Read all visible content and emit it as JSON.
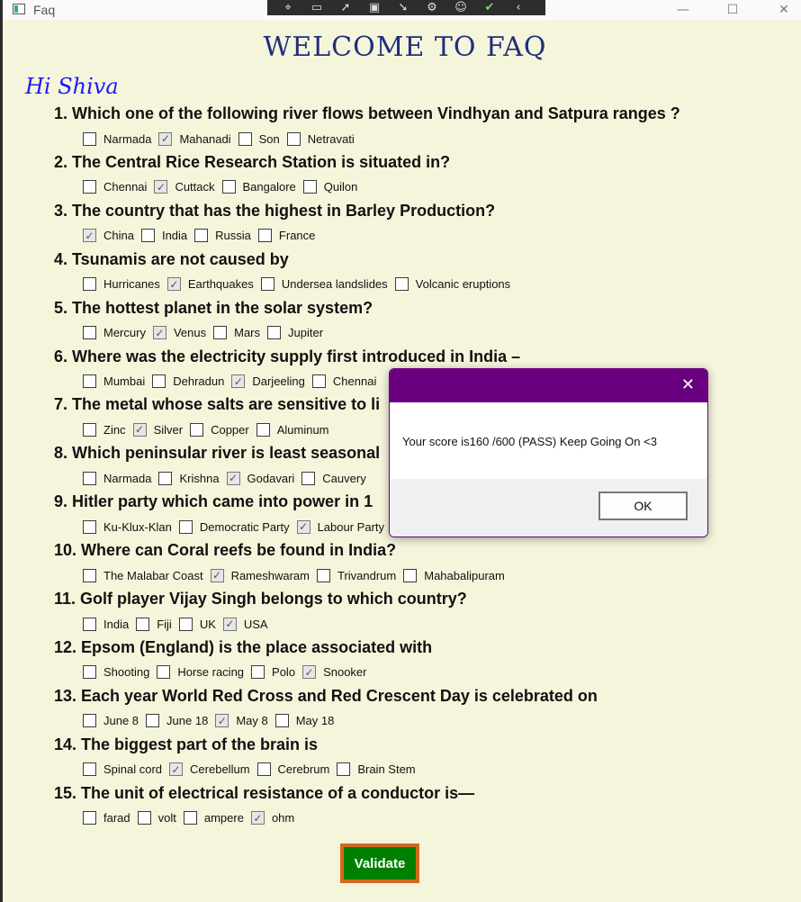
{
  "window": {
    "title": "Faq"
  },
  "toolbar_icons": [
    "region-select-icon",
    "video-icon",
    "cursor-icon",
    "frame-icon",
    "cursor-click-icon",
    "settings-icon",
    "accessibility-icon",
    "check-icon",
    "chevron-left-icon"
  ],
  "heading": "WELCOME TO FAQ",
  "greeting": "Hi Shiva",
  "questions": [
    {
      "text": "1. Which one of the following river flows between Vindhyan and Satpura ranges ?",
      "options": [
        {
          "label": "Narmada",
          "checked": false
        },
        {
          "label": "Mahanadi",
          "checked": true
        },
        {
          "label": "Son",
          "checked": false
        },
        {
          "label": "Netravati",
          "checked": false
        }
      ]
    },
    {
      "text": "2. The Central Rice Research Station is situated in?",
      "options": [
        {
          "label": "Chennai",
          "checked": false
        },
        {
          "label": "Cuttack",
          "checked": true
        },
        {
          "label": "Bangalore",
          "checked": false
        },
        {
          "label": "Quilon",
          "checked": false
        }
      ]
    },
    {
      "text": "3. The country that has the highest in Barley Production?",
      "options": [
        {
          "label": "China",
          "checked": true
        },
        {
          "label": "India",
          "checked": false
        },
        {
          "label": "Russia",
          "checked": false
        },
        {
          "label": "France",
          "checked": false
        }
      ]
    },
    {
      "text": "4. Tsunamis are not caused by",
      "options": [
        {
          "label": "Hurricanes",
          "checked": false
        },
        {
          "label": "Earthquakes",
          "checked": true
        },
        {
          "label": "Undersea landslides",
          "checked": false
        },
        {
          "label": "Volcanic eruptions",
          "checked": false
        }
      ]
    },
    {
      "text": "5. The hottest planet in the solar system?",
      "options": [
        {
          "label": "Mercury",
          "checked": false
        },
        {
          "label": "Venus",
          "checked": true
        },
        {
          "label": "Mars",
          "checked": false
        },
        {
          "label": "Jupiter",
          "checked": false
        }
      ]
    },
    {
      "text": "6. Where was the electricity supply first introduced in India –",
      "options": [
        {
          "label": "Mumbai",
          "checked": false
        },
        {
          "label": "Dehradun",
          "checked": false
        },
        {
          "label": "Darjeeling",
          "checked": true
        },
        {
          "label": "Chennai",
          "checked": false
        }
      ]
    },
    {
      "text": "7. The metal whose salts are sensitive to li",
      "options": [
        {
          "label": "Zinc",
          "checked": false
        },
        {
          "label": "Silver",
          "checked": true
        },
        {
          "label": "Copper",
          "checked": false
        },
        {
          "label": "Aluminum",
          "checked": false
        }
      ]
    },
    {
      "text": "8. Which peninsular river is least seasonal",
      "options": [
        {
          "label": "Narmada",
          "checked": false
        },
        {
          "label": "Krishna",
          "checked": false
        },
        {
          "label": "Godavari",
          "checked": true
        },
        {
          "label": "Cauvery",
          "checked": false
        }
      ]
    },
    {
      "text": "9. Hitler party which came into power in 1",
      "options": [
        {
          "label": "Ku-Klux-Klan",
          "checked": false
        },
        {
          "label": "Democratic Party",
          "checked": false
        },
        {
          "label": "Labour Party",
          "checked": true
        }
      ]
    },
    {
      "text": "10. Where can Coral reefs be found in India?",
      "options": [
        {
          "label": "The Malabar Coast",
          "checked": false
        },
        {
          "label": "Rameshwaram",
          "checked": true
        },
        {
          "label": "Trivandrum",
          "checked": false
        },
        {
          "label": "Mahabalipuram",
          "checked": false
        }
      ]
    },
    {
      "text": "11. Golf player Vijay Singh belongs to which country?",
      "options": [
        {
          "label": "India",
          "checked": false
        },
        {
          "label": "Fiji",
          "checked": false
        },
        {
          "label": "UK",
          "checked": false
        },
        {
          "label": "USA",
          "checked": true
        }
      ]
    },
    {
      "text": "12. Epsom (England) is the place associated with",
      "options": [
        {
          "label": "Shooting",
          "checked": false
        },
        {
          "label": "Horse racing",
          "checked": false
        },
        {
          "label": "Polo",
          "checked": false
        },
        {
          "label": "Snooker",
          "checked": true
        }
      ]
    },
    {
      "text": "13. Each year World Red Cross and Red Crescent Day is celebrated on",
      "options": [
        {
          "label": "June 8",
          "checked": false
        },
        {
          "label": "June 18",
          "checked": false
        },
        {
          "label": "May 8",
          "checked": true
        },
        {
          "label": "May 18",
          "checked": false
        }
      ]
    },
    {
      "text": "14. The biggest part of the brain is",
      "options": [
        {
          "label": "Spinal cord",
          "checked": false
        },
        {
          "label": "Cerebellum",
          "checked": true
        },
        {
          "label": "Cerebrum",
          "checked": false
        },
        {
          "label": "Brain Stem",
          "checked": false
        }
      ]
    },
    {
      "text": "15. The unit of electrical resistance of a conductor is—",
      "options": [
        {
          "label": "farad",
          "checked": false
        },
        {
          "label": "volt",
          "checked": false
        },
        {
          "label": "ampere",
          "checked": false
        },
        {
          "label": "ohm",
          "checked": true
        }
      ]
    }
  ],
  "validate_label": "Validate",
  "dialog": {
    "message": "Your score is160 /600 (PASS) Keep Going On <3",
    "ok_label": "OK"
  },
  "colors": {
    "background": "#f5f5dc",
    "heading": "#1f2e7a",
    "greeting": "#1a1aff",
    "validate_bg": "#008000",
    "validate_border": "#d2691e",
    "dialog_title": "#6a0080"
  }
}
